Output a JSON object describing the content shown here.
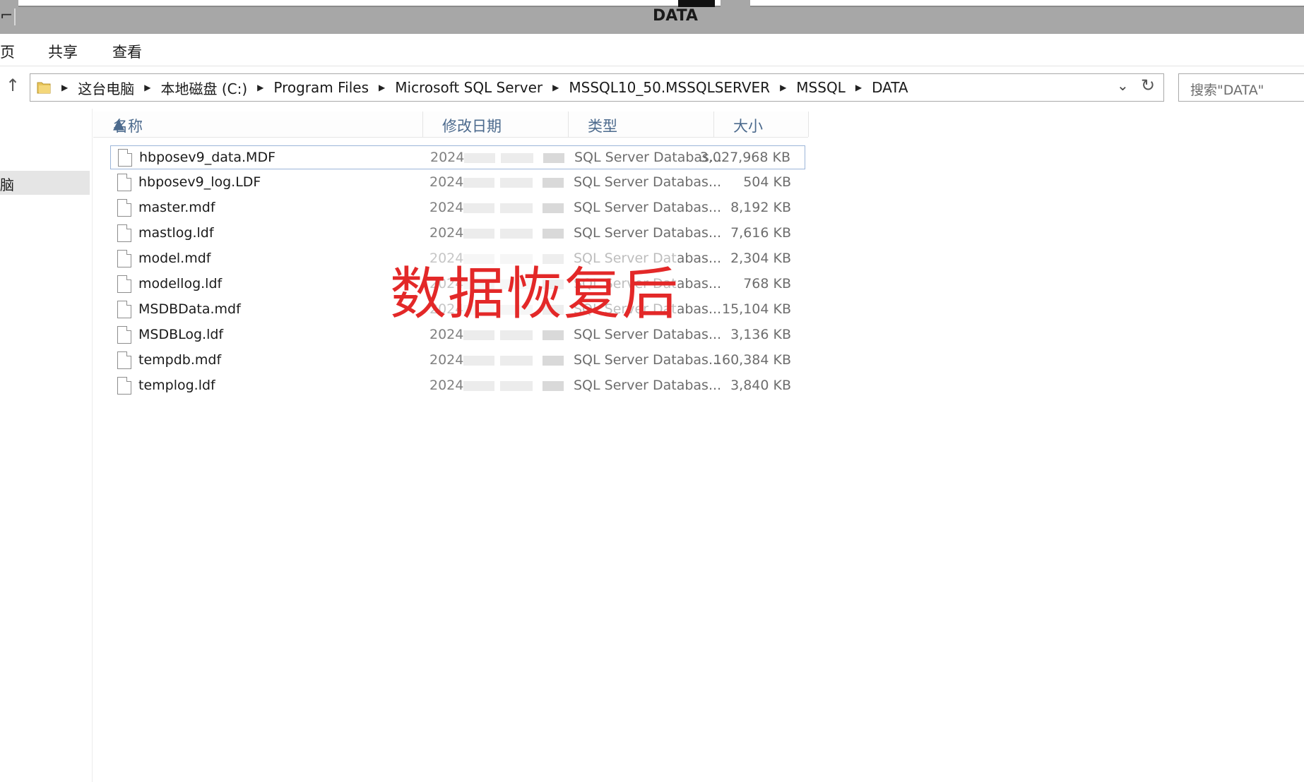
{
  "window": {
    "title": "DATA"
  },
  "ribbon": {
    "tabs": [
      "页",
      "共享",
      "查看"
    ]
  },
  "address": {
    "crumbs": [
      "这台电脑",
      "本地磁盘 (C:)",
      "Program Files",
      "Microsoft SQL Server",
      "MSSQL10_50.MSSQLSERVER",
      "MSSQL",
      "DATA"
    ]
  },
  "search": {
    "placeholder": "搜索\"DATA\""
  },
  "nav": {
    "selected_label": "脑"
  },
  "columns": {
    "name": "名称",
    "date": "修改日期",
    "type": "类型",
    "size": "大小"
  },
  "files": [
    {
      "name": "hbposev9_data.MDF",
      "date": "2024",
      "type": "SQL Server Databas...",
      "size": "3,027,968 KB",
      "selected": true
    },
    {
      "name": "hbposev9_log.LDF",
      "date": "2024",
      "type": "SQL Server Databas...",
      "size": "504 KB"
    },
    {
      "name": "master.mdf",
      "date": "2024",
      "type": "SQL Server Databas...",
      "size": "8,192 KB"
    },
    {
      "name": "mastlog.ldf",
      "date": "2024",
      "type": "SQL Server Databas...",
      "size": "7,616 KB"
    },
    {
      "name": "model.mdf",
      "date": "2024",
      "type": "SQL Server Databas...",
      "size": "2,304 KB"
    },
    {
      "name": "modellog.ldf",
      "date": "2024",
      "type": "SQL Server Databas...",
      "size": "768 KB"
    },
    {
      "name": "MSDBData.mdf",
      "date": "2024",
      "type": "SQL Server Databas...",
      "size": "15,104 KB"
    },
    {
      "name": "MSDBLog.ldf",
      "date": "2024",
      "type": "SQL Server Databas...",
      "size": "3,136 KB"
    },
    {
      "name": "tempdb.mdf",
      "date": "2024",
      "type": "SQL Server Databas...",
      "size": "160,384 KB"
    },
    {
      "name": "templog.ldf",
      "date": "2024",
      "type": "SQL Server Databas...",
      "size": "3,840 KB"
    }
  ],
  "overlay_text": "数据恢复后",
  "colors": {
    "overlay": "#e32828",
    "header_text": "#4c6a8d",
    "selection_border": "#9bb5d9"
  },
  "icons": {
    "up": "arrow-up-icon",
    "folder": "folder-icon",
    "file": "file-icon",
    "refresh": "refresh-icon",
    "dropdown": "chevron-down-icon"
  }
}
